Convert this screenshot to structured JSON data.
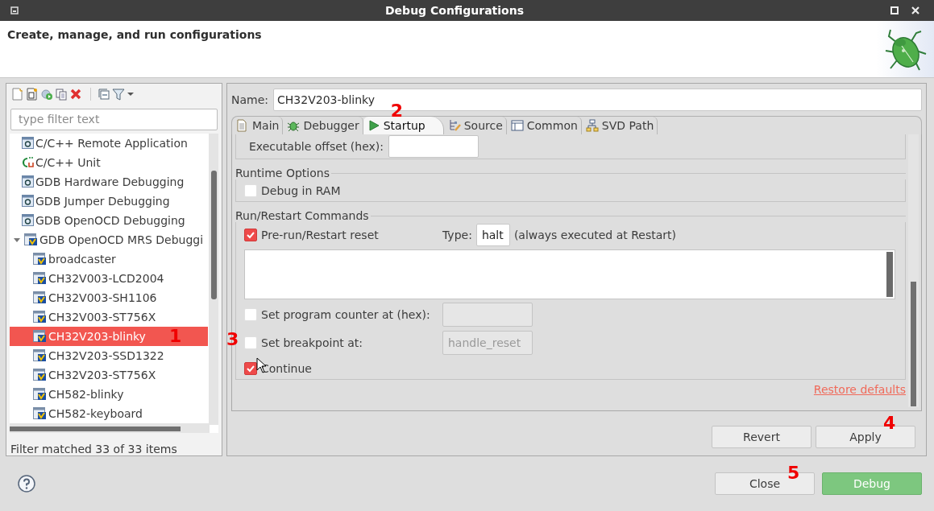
{
  "window": {
    "title": "Debug Configurations"
  },
  "header": {
    "title": "Create, manage, and run configurations"
  },
  "filter": {
    "placeholder": "type filter text"
  },
  "tree": [
    {
      "kind": "c-app",
      "label": "C/C++ Remote Application",
      "selected": false
    },
    {
      "kind": "c-unit",
      "label": "C/C++ Unit",
      "selected": false
    },
    {
      "kind": "c-app",
      "label": "GDB Hardware Debugging",
      "selected": false
    },
    {
      "kind": "c-app",
      "label": "GDB Jumper Debugging",
      "selected": false
    },
    {
      "kind": "c-app",
      "label": "GDB OpenOCD Debugging",
      "selected": false
    },
    {
      "kind": "mrs",
      "label": "GDB OpenOCD MRS Debuggi",
      "selected": false,
      "expanded": true,
      "children": [
        {
          "kind": "mrs",
          "label": "broadcaster",
          "selected": false
        },
        {
          "kind": "mrs",
          "label": "CH32V003-LCD2004",
          "selected": false
        },
        {
          "kind": "mrs",
          "label": "CH32V003-SH1106",
          "selected": false
        },
        {
          "kind": "mrs",
          "label": "CH32V003-ST756X",
          "selected": false
        },
        {
          "kind": "mrs",
          "label": "CH32V203-blinky",
          "selected": true,
          "marker": "1"
        },
        {
          "kind": "mrs",
          "label": "CH32V203-SSD1322",
          "selected": false
        },
        {
          "kind": "mrs",
          "label": "CH32V203-ST756X",
          "selected": false
        },
        {
          "kind": "mrs",
          "label": "CH582-blinky",
          "selected": false
        },
        {
          "kind": "mrs",
          "label": "CH582-keyboard",
          "selected": false
        }
      ]
    }
  ],
  "filter_status": "Filter matched 33 of 33 items",
  "name": {
    "label": "Name:",
    "value": "CH32V203-blinky"
  },
  "tabs": [
    {
      "label": "Main",
      "selected": false
    },
    {
      "label": "Debugger",
      "selected": false
    },
    {
      "label": "Startup",
      "selected": true,
      "marker": "2"
    },
    {
      "label": "Source",
      "selected": false
    },
    {
      "label": "Common",
      "selected": false
    },
    {
      "label": "SVD Path",
      "selected": false
    }
  ],
  "startup": {
    "offset_label": "Executable offset (hex):",
    "groups": [
      {
        "title": "Runtime Options",
        "rows": [
          {
            "kind": "check",
            "label": "Debug in RAM",
            "checked": false
          }
        ]
      },
      {
        "title": "Run/Restart Commands",
        "rows": [
          {
            "kind": "check-type",
            "label": "Pre-run/Restart reset",
            "checked": true,
            "type_label": "Type:",
            "type_value": "halt",
            "note": "(always executed at Restart)"
          },
          {
            "kind": "textarea"
          },
          {
            "kind": "check-field",
            "label": "Set program counter at (hex):",
            "checked": false,
            "disabled": true
          },
          {
            "kind": "check-field",
            "label": "Set breakpoint at:",
            "checked": false,
            "disabled": true,
            "value": "handle_reset",
            "marker": "3"
          },
          {
            "kind": "check",
            "label": "Continue",
            "checked": true
          }
        ]
      }
    ],
    "restore_defaults": "Restore defaults"
  },
  "panel_buttons": [
    {
      "label": "Revert"
    },
    {
      "label": "Apply",
      "marker": "4"
    }
  ],
  "dialog_buttons": [
    {
      "label": "Close",
      "primary": false,
      "marker": "5"
    },
    {
      "label": "Debug",
      "primary": true
    }
  ]
}
